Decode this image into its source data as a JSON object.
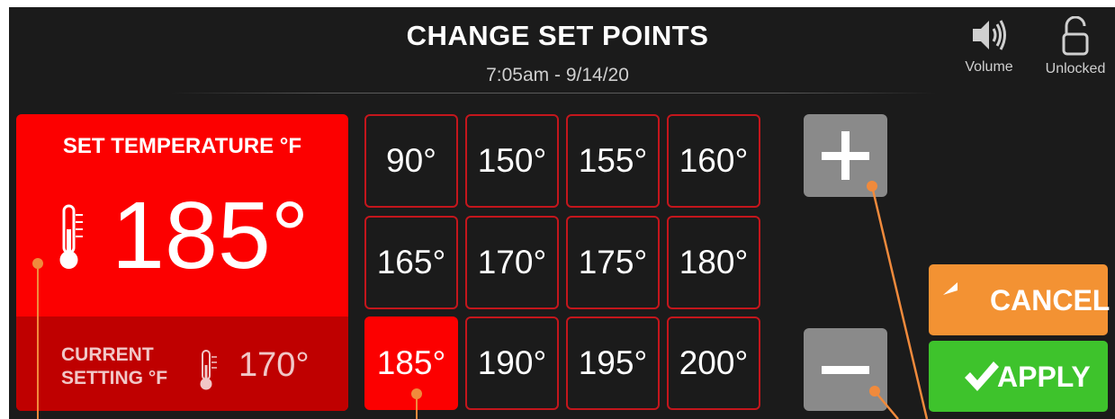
{
  "header": {
    "title": "CHANGE SET POINTS",
    "datetime": "7:05am - 9/14/20"
  },
  "top_icons": [
    {
      "icon": "speaker-icon",
      "label": "Volume"
    },
    {
      "icon": "unlocked-padlock-icon",
      "label": "Unlocked"
    }
  ],
  "set_panel": {
    "label": "SET TEMPERATURE °F",
    "value": "185°",
    "icon": "thermometer-icon",
    "current_label_line1": "CURRENT",
    "current_label_line2": "SETTING °F",
    "current_value": "170°"
  },
  "presets": [
    "90°",
    "150°",
    "155°",
    "160°",
    "165°",
    "170°",
    "175°",
    "180°",
    "185°",
    "190°",
    "195°",
    "200°"
  ],
  "selected_preset": "185°",
  "stepper": {
    "increase_icon": "plus-icon",
    "decrease_icon": "minus-icon"
  },
  "actions": {
    "cancel_label": "CANCEL",
    "apply_label": "APPLY",
    "cancel_color": "#f39233",
    "apply_color": "#3ec32c"
  },
  "colors": {
    "background": "#1b1b1b",
    "accent_red": "#fc0000",
    "dark_red": "#bf0000",
    "preset_border": "#c4161c",
    "callout_orange": "#f08a3c"
  }
}
